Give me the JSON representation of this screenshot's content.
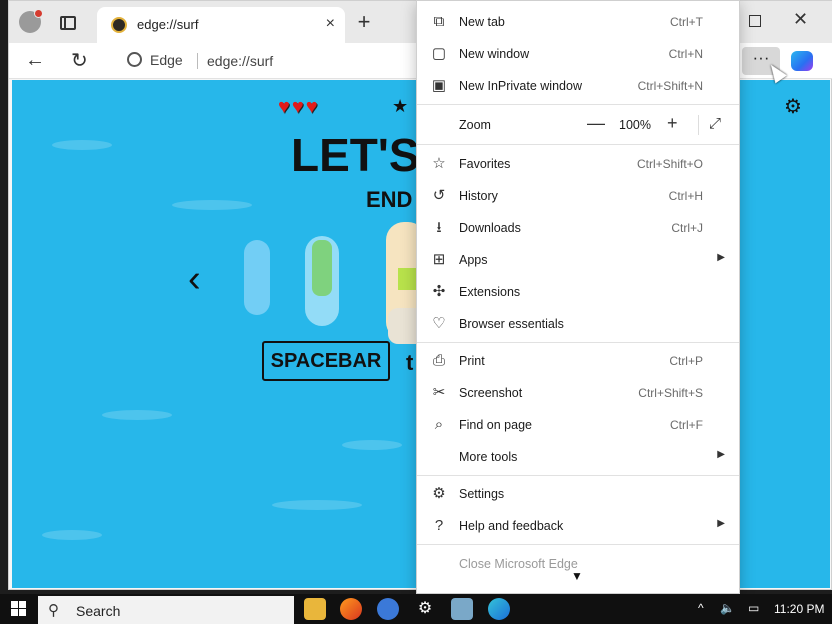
{
  "tab": {
    "title": "edge://surf",
    "close": "×"
  },
  "toolbar": {
    "new_tab": "+",
    "site_label": "Edge",
    "url": "edge://surf",
    "more": "···"
  },
  "game": {
    "hearts": "♥♥♥",
    "star": "★",
    "title": "LET'S",
    "subtitle": "END",
    "key_label": "SPACEBAR",
    "key_suffix": "t",
    "prev_arrow": "‹",
    "settings_icon": "⚙"
  },
  "menu": {
    "items": [
      {
        "label": "New tab",
        "shortcut": "Ctrl+T",
        "icon": "new-tab-icon"
      },
      {
        "label": "New window",
        "shortcut": "Ctrl+N",
        "icon": "new-window-icon"
      },
      {
        "label": "New InPrivate window",
        "shortcut": "Ctrl+Shift+N",
        "icon": "inprivate-icon"
      },
      {
        "label": "Zoom",
        "zoom_value": "100%",
        "zoom_minus": "—",
        "zoom_plus": "+",
        "fullscreen": "⤢"
      },
      {
        "label": "Favorites",
        "shortcut": "Ctrl+Shift+O",
        "icon": "favorites-icon"
      },
      {
        "label": "History",
        "shortcut": "Ctrl+H",
        "icon": "history-icon"
      },
      {
        "label": "Downloads",
        "shortcut": "Ctrl+J",
        "icon": "downloads-icon"
      },
      {
        "label": "Apps",
        "icon": "apps-icon",
        "arrow": "▶"
      },
      {
        "label": "Extensions",
        "icon": "extensions-icon"
      },
      {
        "label": "Browser essentials",
        "icon": "essentials-icon"
      },
      {
        "label": "Print",
        "shortcut": "Ctrl+P",
        "icon": "print-icon"
      },
      {
        "label": "Screenshot",
        "shortcut": "Ctrl+Shift+S",
        "icon": "screenshot-icon"
      },
      {
        "label": "Find on page",
        "shortcut": "Ctrl+F",
        "icon": "find-icon"
      },
      {
        "label": "More tools",
        "arrow": "▶"
      },
      {
        "label": "Settings",
        "icon": "settings-icon"
      },
      {
        "label": "Help and feedback",
        "icon": "help-icon",
        "arrow": "▶"
      }
    ],
    "partial_item": "Close Microsoft Edge",
    "scroll_arrow": "▼"
  },
  "taskbar": {
    "search_label": "Search",
    "search_icon": "⚲",
    "tray_chevron": "^",
    "volume": "🔈",
    "network": "▭",
    "time": "11:20 PM"
  },
  "colors": {
    "game_bg": "#27b7ea",
    "menu_bg": "#ffffff",
    "taskbar_bg": "#101010"
  }
}
